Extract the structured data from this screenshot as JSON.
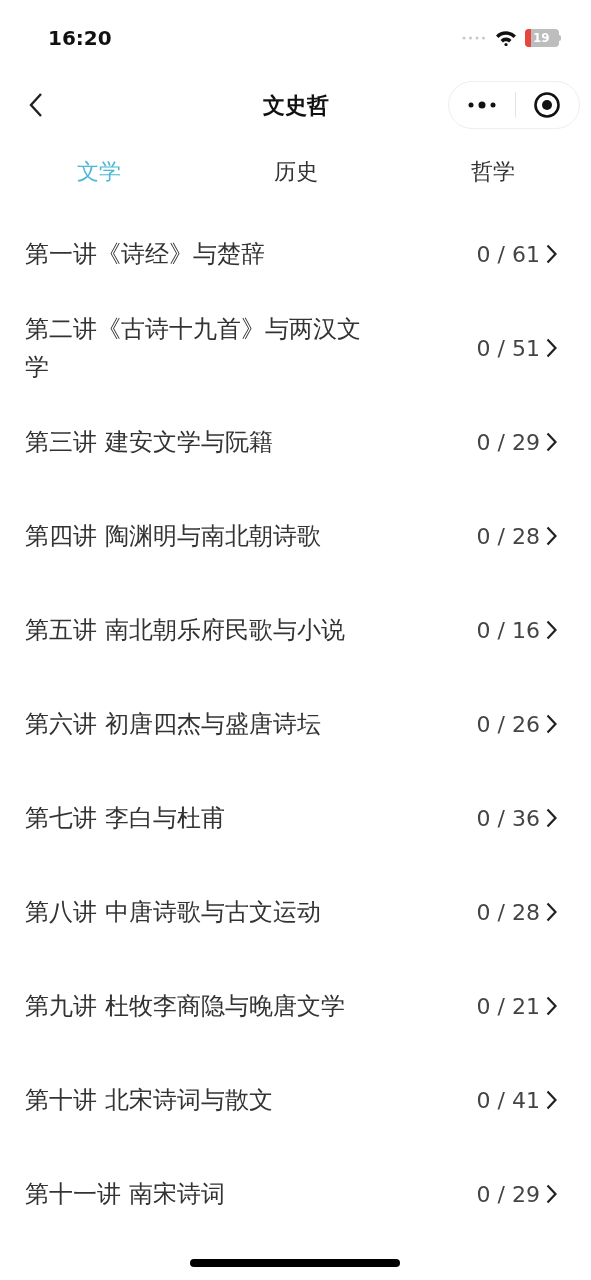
{
  "status_bar": {
    "time": "16:20",
    "battery": "19"
  },
  "nav": {
    "title": "文史哲"
  },
  "tabs": [
    {
      "label": "文学",
      "selected": true
    },
    {
      "label": "历史",
      "selected": false
    },
    {
      "label": "哲学",
      "selected": false
    }
  ],
  "lectures": [
    {
      "title": "第一讲《诗经》与楚辞",
      "progress": "0 / 61"
    },
    {
      "title": "第二讲《古诗十九首》与两汉文学",
      "progress": "0 / 51"
    },
    {
      "title": "第三讲 建安文学与阮籍",
      "progress": "0 / 29"
    },
    {
      "title": "第四讲 陶渊明与南北朝诗歌",
      "progress": "0 / 28"
    },
    {
      "title": "第五讲 南北朝乐府民歌与小说",
      "progress": "0 / 16"
    },
    {
      "title": "第六讲 初唐四杰与盛唐诗坛",
      "progress": "0 / 26"
    },
    {
      "title": "第七讲 李白与杜甫",
      "progress": "0 / 36"
    },
    {
      "title": "第八讲 中唐诗歌与古文运动",
      "progress": "0 / 28"
    },
    {
      "title": "第九讲 杜牧李商隐与晚唐文学",
      "progress": "0 / 21"
    },
    {
      "title": "第十讲 北宋诗词与散文",
      "progress": "0 / 41"
    },
    {
      "title": "第十一讲 南宋诗词",
      "progress": "0 / 29"
    }
  ]
}
